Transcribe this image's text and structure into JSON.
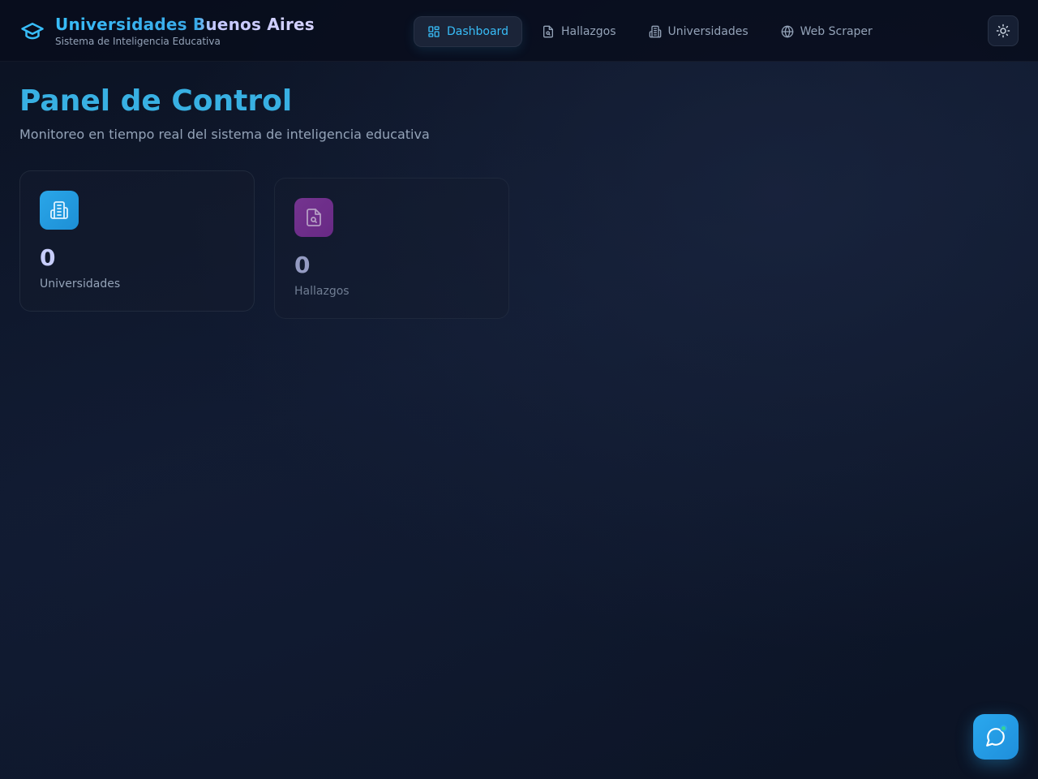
{
  "brand": {
    "title": "Universidades Buenos Aires",
    "subtitle": "Sistema de Inteligencia Educativa",
    "icon": "graduation-cap-icon"
  },
  "nav": {
    "items": [
      {
        "label": "Dashboard",
        "icon": "layout-grid-icon",
        "active": true
      },
      {
        "label": "Hallazgos",
        "icon": "file-search-icon",
        "active": false
      },
      {
        "label": "Universidades",
        "icon": "building-icon",
        "active": false
      },
      {
        "label": "Web Scraper",
        "icon": "globe-icon",
        "active": false
      }
    ]
  },
  "theme_toggle": {
    "icon": "sun-icon"
  },
  "page": {
    "title": "Panel de Control",
    "subtitle": "Monitoreo en tiempo real del sistema de inteligencia educativa"
  },
  "stats": [
    {
      "value": "0",
      "label": "Universidades",
      "icon": "building-icon",
      "color": "#2aa6e8"
    },
    {
      "value": "0",
      "label": "Hallazgos",
      "icon": "file-search-icon",
      "color": "#9b3fb5"
    }
  ],
  "chat": {
    "icon": "message-circle-icon",
    "status_color": "#34d399"
  },
  "colors": {
    "accent": "#38bdf8",
    "background": "#0c1325"
  }
}
